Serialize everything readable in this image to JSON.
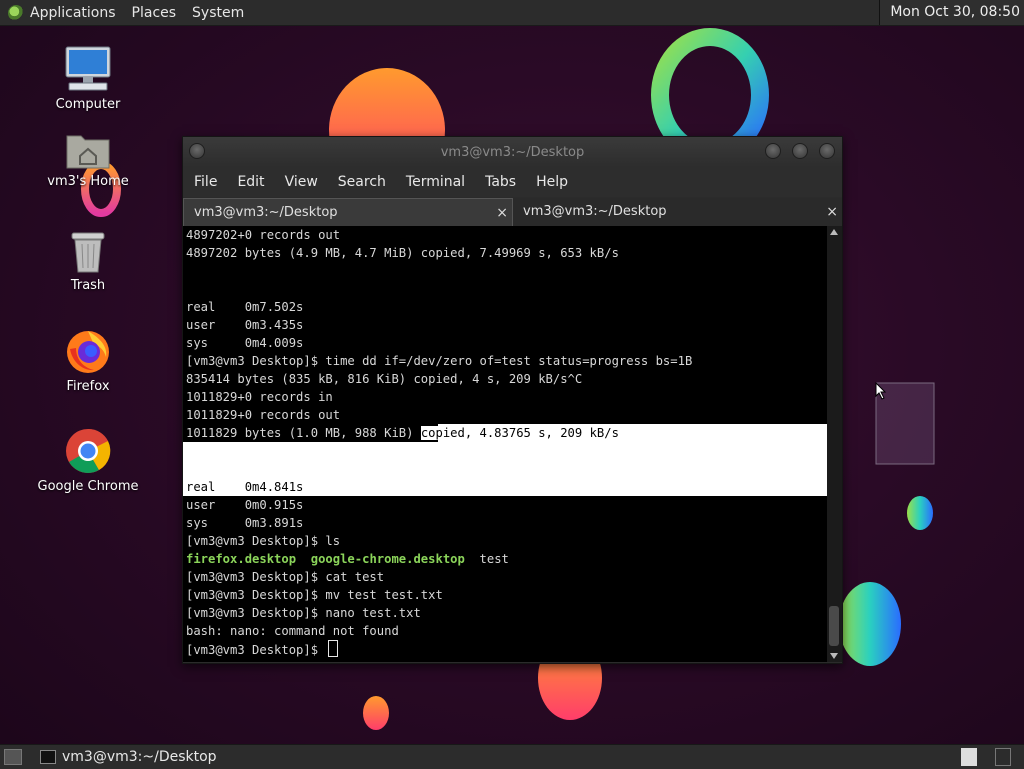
{
  "top_panel": {
    "menus": [
      "Applications",
      "Places",
      "System"
    ],
    "clock": "Mon Oct 30, 08:50"
  },
  "desktop_icons": [
    {
      "label": "Computer",
      "icon": "computer-icon"
    },
    {
      "label": "vm3's Home",
      "icon": "home-folder-icon"
    },
    {
      "label": "Trash",
      "icon": "trash-icon"
    },
    {
      "label": "Firefox",
      "icon": "firefox-icon"
    },
    {
      "label": "Google Chrome",
      "icon": "chrome-icon"
    }
  ],
  "terminal": {
    "title": "vm3@vm3:~/Desktop",
    "menu": [
      "File",
      "Edit",
      "View",
      "Search",
      "Terminal",
      "Tabs",
      "Help"
    ],
    "tabs": [
      {
        "label": "vm3@vm3:~/Desktop",
        "close": "×",
        "active": true
      },
      {
        "label": "vm3@vm3:~/Desktop",
        "close": "×",
        "active": false
      }
    ],
    "lines": {
      "l0": "4897202+0 records out",
      "l1": "4897202 bytes (4.9 MB, 4.7 MiB) copied, 7.49969 s, 653 kB/s",
      "l4": "real    0m7.502s",
      "l5": "user    0m3.435s",
      "l6": "sys     0m4.009s",
      "l7": "[vm3@vm3 Desktop]$ time dd if=/dev/zero of=test status=progress bs=1B",
      "l8": "835414 bytes (835 kB, 816 KiB) copied, 4 s, 209 kB/s^C",
      "l9": "1011829+0 records in",
      "l10": "1011829+0 records out",
      "l11a": "1011829 bytes (1.0 MB, 988 KiB) ",
      "l11b": "copied, 4.83765 s, 209 kB/s",
      "l14": "real    0m4.841s",
      "l15": "user    0m0.915s",
      "l16": "sys     0m3.891s",
      "l17": "[vm3@vm3 Desktop]$ ls",
      "l18a": "firefox.desktop",
      "l18b": "google-chrome.desktop",
      "l18c": "test",
      "l19": "[vm3@vm3 Desktop]$ cat test",
      "l20": "[vm3@vm3 Desktop]$ mv test test.txt",
      "l21": "[vm3@vm3 Desktop]$ nano test.txt",
      "l22": "bash: nano: command not found",
      "l23": "[vm3@vm3 Desktop]$ "
    }
  },
  "taskbar": {
    "window_button": "vm3@vm3:~/Desktop"
  },
  "colors": {
    "panel": "#2c2c2c",
    "desktop_bg": "#2a0a26",
    "ls_green": "#8bd45a"
  }
}
